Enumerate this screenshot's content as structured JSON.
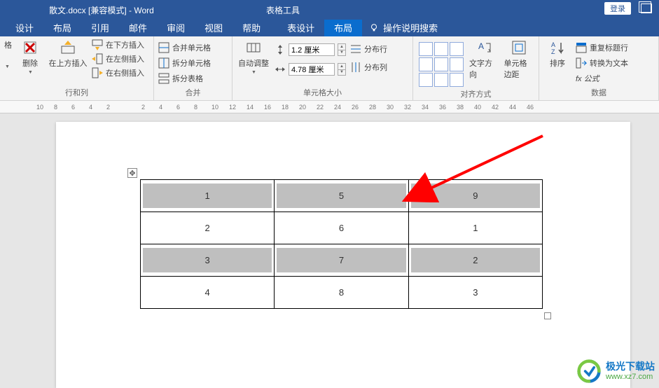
{
  "title": {
    "doc_name": "散文.docx [兼容模式] - Word",
    "table_tools": "表格工具",
    "login": "登录"
  },
  "menu": {
    "items": [
      "设计",
      "布局",
      "引用",
      "邮件",
      "审阅",
      "视图",
      "帮助",
      "表设计",
      "布局"
    ],
    "tellme_placeholder": "操作说明搜索"
  },
  "ribbon": {
    "rows_cols": {
      "select_partial": "格",
      "delete": "删除",
      "insert_above": "在上方插入",
      "insert_below": "在下方插入",
      "insert_left": "在左侧插入",
      "insert_right": "在右侧插入",
      "label": "行和列"
    },
    "merge": {
      "merge_cells": "合并单元格",
      "split_cells": "拆分单元格",
      "split_table": "拆分表格",
      "label": "合并"
    },
    "cell_size": {
      "autofit": "自动调整",
      "height_value": "1.2 厘米",
      "width_value": "4.78 厘米",
      "distrib_rows": "分布行",
      "distrib_cols": "分布列",
      "label": "单元格大小"
    },
    "alignment": {
      "text_dir": "文字方向",
      "cell_margins": "单元格边距",
      "label": "对齐方式"
    },
    "data": {
      "sort": "排序",
      "repeat_header": "重复标题行",
      "to_text": "转换为文本",
      "formula": "fx 公式",
      "label": "数据"
    }
  },
  "ruler_ticks": [
    "10",
    "8",
    "6",
    "4",
    "2",
    "",
    "2",
    "4",
    "6",
    "8",
    "10",
    "12",
    "14",
    "16",
    "18",
    "20",
    "22",
    "24",
    "26",
    "28",
    "30",
    "32",
    "34",
    "36",
    "38",
    "40",
    "42",
    "44",
    "46"
  ],
  "table_data": [
    [
      "1",
      "5",
      "9"
    ],
    [
      "2",
      "6",
      "1"
    ],
    [
      "3",
      "7",
      "2"
    ],
    [
      "4",
      "8",
      "3"
    ]
  ],
  "watermark": {
    "line1": "极光下载站",
    "line2": "www.xz7.com"
  }
}
